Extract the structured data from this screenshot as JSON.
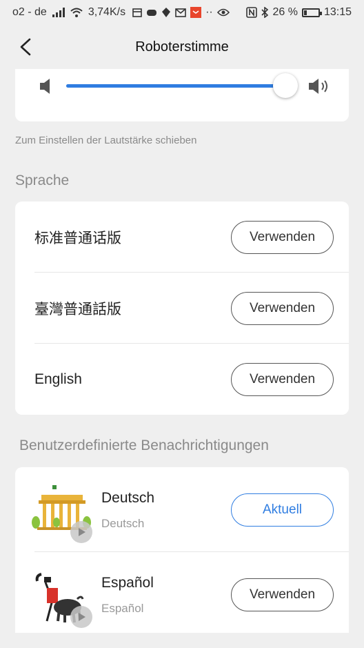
{
  "status_bar": {
    "carrier": "o2 - de",
    "speed": "3,74K/s",
    "battery": "26 %",
    "battery_level": 0.26,
    "time": "13:15",
    "icons": [
      "signal-icon",
      "wifi-icon",
      "calendar-icon",
      "game-icon",
      "location-icon",
      "mail-icon",
      "app-icon",
      "dots-icon",
      "eye-icon",
      "nfc-icon",
      "bluetooth-icon",
      "battery-icon"
    ]
  },
  "header": {
    "title": "Roboterstimme",
    "back_icon": "back-arrow-icon"
  },
  "volume": {
    "level": 1.0,
    "hint": "Zum Einstellen der Lautstärke schieben",
    "low_icon": "speaker-low-icon",
    "high_icon": "speaker-high-icon"
  },
  "language_section": {
    "title": "Sprache",
    "items": [
      {
        "label": "标准普通话版",
        "button": "Verwenden"
      },
      {
        "label": "臺灣普通話版",
        "button": "Verwenden"
      },
      {
        "label": "English",
        "button": "Verwenden"
      }
    ]
  },
  "custom_section": {
    "title": "Benutzerdefinierte Benachrichtigungen",
    "items": [
      {
        "name": "Deutsch",
        "subtitle": "Deutsch",
        "button": "Aktuell",
        "active": true,
        "image_icon": "brandenburg-gate-icon"
      },
      {
        "name": "Español",
        "subtitle": "Español",
        "button": "Verwenden",
        "active": false,
        "image_icon": "bullfighter-icon"
      }
    ]
  },
  "colors": {
    "accent": "#2f7de1",
    "background": "#efefef",
    "card": "#ffffff"
  }
}
